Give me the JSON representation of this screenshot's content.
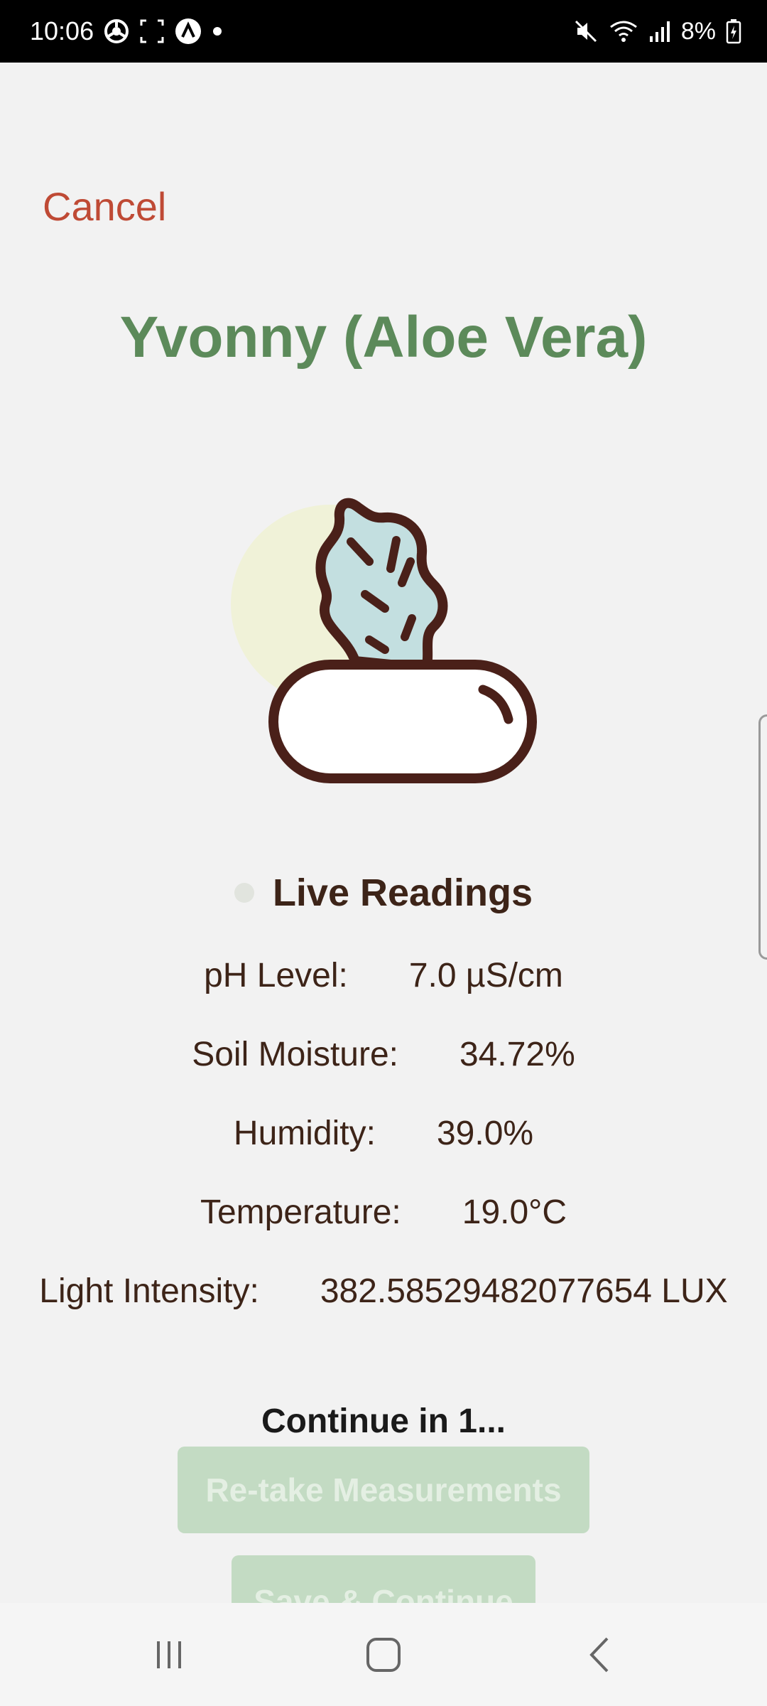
{
  "status_bar": {
    "time": "10:06",
    "battery": "8%",
    "icons_left": [
      "chrome-icon",
      "screenshot-icon",
      "app-icon",
      "dot-icon"
    ],
    "icons_right": [
      "mute-icon",
      "wifi-icon",
      "signal-icon",
      "battery-icon"
    ]
  },
  "header": {
    "cancel_label": "Cancel",
    "plant_title": "Yvonny (Aloe Vera)"
  },
  "illustration": {
    "icon": "aloe-plant-icon",
    "colors": {
      "sun": "#f0f2d8",
      "leaf": "#c3dfe0",
      "outline": "#4a2019",
      "pot": "#ffffff"
    }
  },
  "readings": {
    "title": "Live Readings",
    "items": [
      {
        "label": "pH Level:",
        "value": "7.0 µS/cm"
      },
      {
        "label": "Soil Moisture:",
        "value": "34.72%"
      },
      {
        "label": "Humidity:",
        "value": "39.0%"
      },
      {
        "label": "Temperature:",
        "value": "19.0°C"
      },
      {
        "label": "Light Intensity:",
        "value": "382.58529482077654 LUX"
      }
    ]
  },
  "footer": {
    "continue_text": "Continue in 1...",
    "retake_label": "Re-take Measurements",
    "save_label": "Save & Continue"
  },
  "colors": {
    "accent_green": "#5c8a5a",
    "cancel_red": "#bf4a35",
    "text_brown": "#3d2418",
    "disabled_button": "#c3dbc3"
  }
}
